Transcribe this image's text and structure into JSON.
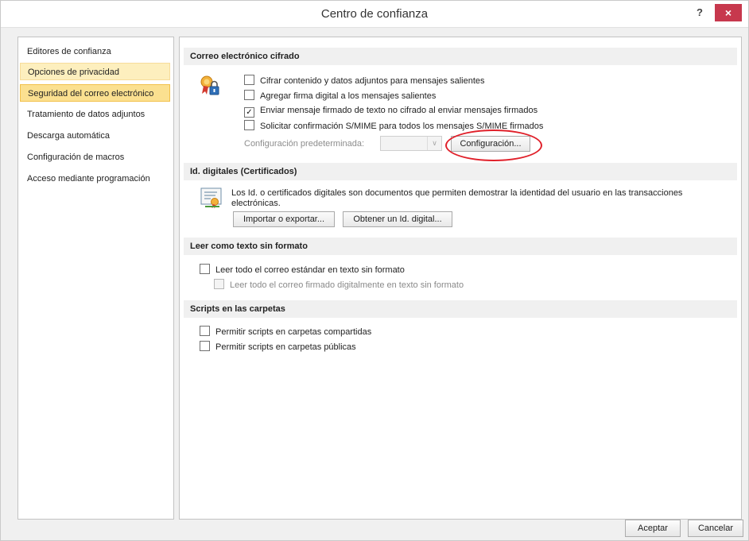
{
  "window": {
    "title": "Centro de confianza",
    "help_label": "?",
    "close_label": "×"
  },
  "nav": {
    "items": [
      {
        "label": "Editores de confianza",
        "state": "normal"
      },
      {
        "label": "Opciones de privacidad",
        "state": "hover"
      },
      {
        "label": "Seguridad del correo electrónico",
        "state": "selected"
      },
      {
        "label": "Tratamiento de datos adjuntos",
        "state": "normal"
      },
      {
        "label": "Descarga automática",
        "state": "normal"
      },
      {
        "label": "Configuración de macros",
        "state": "normal"
      },
      {
        "label": "Acceso mediante programación",
        "state": "normal"
      }
    ]
  },
  "encrypted_email": {
    "header": "Correo electrónico cifrado",
    "options": [
      {
        "label": "Cifrar contenido y datos adjuntos para mensajes salientes",
        "checked": false
      },
      {
        "label": "Agregar firma digital a los mensajes salientes",
        "checked": false
      },
      {
        "label": "Enviar mensaje firmado de texto no cifrado al enviar mensajes firmados",
        "checked": true
      },
      {
        "label": "Solicitar confirmación S/MIME para todos los mensajes S/MIME firmados",
        "checked": false
      }
    ],
    "default_setting_label": "Configuración predeterminada:",
    "default_setting_value": "",
    "settings_button": "Configuración..."
  },
  "digital_ids": {
    "header": "Id. digitales (Certificados)",
    "description": "Los Id. o certificados digitales son documentos que permiten demostrar la identidad del usuario en las transacciones electrónicas.",
    "import_export_button": "Importar o exportar...",
    "get_id_button": "Obtener un Id. digital..."
  },
  "plain_text": {
    "header": "Leer como texto sin formato",
    "options": [
      {
        "label": "Leer todo el correo estándar en texto sin formato",
        "checked": false,
        "disabled": false
      },
      {
        "label": "Leer todo el correo firmado digitalmente en texto sin formato",
        "checked": false,
        "disabled": true
      }
    ]
  },
  "folder_scripts": {
    "header": "Scripts en las carpetas",
    "options": [
      {
        "label": "Permitir scripts en carpetas compartidas",
        "checked": false
      },
      {
        "label": "Permitir scripts en carpetas públicas",
        "checked": false
      }
    ]
  },
  "footer": {
    "ok_button": "Aceptar",
    "cancel_button": "Cancelar"
  },
  "colors": {
    "selected_nav": "#fbe090",
    "close_button": "#c7384d",
    "highlight_ring": "#e0202a"
  },
  "icons": {
    "encrypted_email_icon": "ribbon-lock-icon",
    "digital_id_icon": "certificate-icon"
  }
}
